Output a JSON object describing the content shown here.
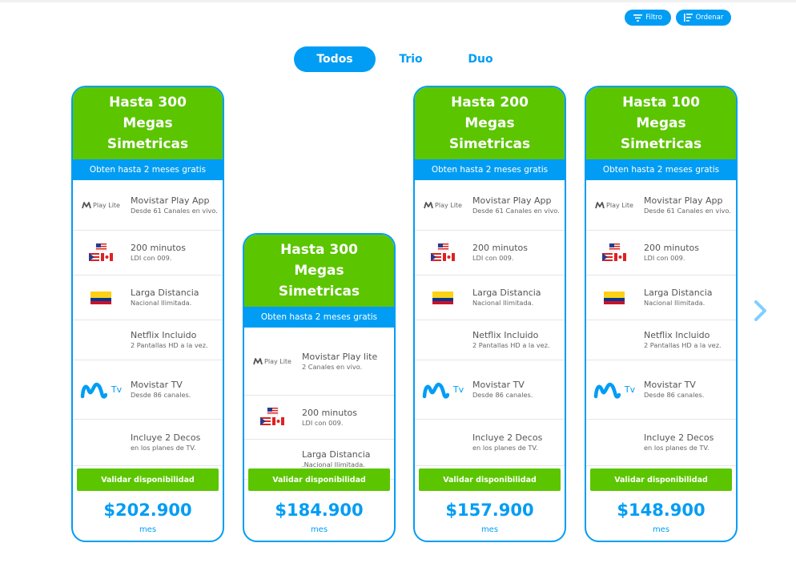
{
  "toolbar": {
    "filter_label": "Filtro",
    "sort_label": "Ordenar"
  },
  "tabs": [
    {
      "label": "Todos"
    },
    {
      "label": "Trio"
    },
    {
      "label": "Duo"
    }
  ],
  "colors": {
    "accent": "#019df4",
    "green": "#5bc500"
  },
  "cards": [
    {
      "title": "Hasta 300 Megas Simetricas",
      "promo": "Obten hasta 2 meses gratis",
      "features": [
        {
          "icon": "movistar-play-lite-logo",
          "logo_text": "Play Lite",
          "title": "Movistar Play App",
          "sub": "Desde 61 Canales en vivo."
        },
        {
          "icon": "flags-icon",
          "title": "200 minutos",
          "sub": "LDI con 009."
        },
        {
          "icon": "colombia-flag-icon",
          "title": "Larga Distancia",
          "sub": "Nacional Ilimitada."
        },
        {
          "icon": "none",
          "title": "Netflix Incluido",
          "sub": "2 Pantallas HD a la vez."
        },
        {
          "icon": "movistar-tv-logo",
          "logo_text": "Tv",
          "title": "Movistar TV",
          "sub": "Desde 86 canales."
        },
        {
          "icon": "none",
          "title": "Incluye 2 Decos",
          "sub": "en los planes de TV."
        }
      ],
      "button": "Validar disponibilidad",
      "price": "$202.900",
      "period": "mes"
    },
    {
      "title": "Hasta 300 Megas Simetricas",
      "promo": "Obten hasta 2 meses gratis",
      "features": [
        {
          "icon": "movistar-play-lite-logo",
          "logo_text": "Play Lite",
          "title": "Movistar Play lite",
          "sub": "2 Canales en vivo."
        },
        {
          "icon": "flags-icon",
          "title": "200 minutos",
          "sub": "LDI con 009."
        },
        {
          "icon": "none",
          "title": "Larga Distancia",
          "sub": ".Nacional Ilimitada."
        }
      ],
      "button": "Validar disponibilidad",
      "price": "$184.900",
      "period": "mes"
    },
    {
      "title": "Hasta 200 Megas Simetricas",
      "promo": "Obten hasta 2 meses gratis",
      "features": [
        {
          "icon": "movistar-play-lite-logo",
          "logo_text": "Play Lite",
          "title": "Movistar Play App",
          "sub": "Desde 61 Canales en vivo."
        },
        {
          "icon": "flags-icon",
          "title": "200 minutos",
          "sub": "LDI con 009."
        },
        {
          "icon": "colombia-flag-icon",
          "title": "Larga Distancia",
          "sub": "Nacional Ilimitada."
        },
        {
          "icon": "none",
          "title": "Netflix Incluido",
          "sub": "2 Pantallas HD a la vez."
        },
        {
          "icon": "movistar-tv-logo",
          "logo_text": "Tv",
          "title": "Movistar TV",
          "sub": "Desde 86 canales."
        },
        {
          "icon": "none",
          "title": "Incluye 2 Decos",
          "sub": "en los planes de TV."
        }
      ],
      "button": "Validar disponibilidad",
      "price": "$157.900",
      "period": "mes"
    },
    {
      "title": "Hasta 100 Megas Simetricas",
      "promo": "Obten hasta 2 meses gratis",
      "features": [
        {
          "icon": "movistar-play-lite-logo",
          "logo_text": "Play Lite",
          "title": "Movistar Play App",
          "sub": "Desde 61 Canales en vivo."
        },
        {
          "icon": "flags-icon",
          "title": "200 minutos",
          "sub": "LDI con 009."
        },
        {
          "icon": "colombia-flag-icon",
          "title": "Larga Distancia",
          "sub": "Nacional Ilimitada."
        },
        {
          "icon": "none",
          "title": "Netflix Incluido",
          "sub": "2 Pantallas HD a la vez."
        },
        {
          "icon": "movistar-tv-logo",
          "logo_text": "Tv",
          "title": "Movistar TV",
          "sub": "Desde 86 canales."
        },
        {
          "icon": "none",
          "title": "Incluye 2 Decos",
          "sub": "en los planes de TV."
        }
      ],
      "button": "Validar disponibilidad",
      "price": "$148.900",
      "period": "mes"
    }
  ],
  "carousel": {
    "next_icon": "chevron-right-icon"
  }
}
